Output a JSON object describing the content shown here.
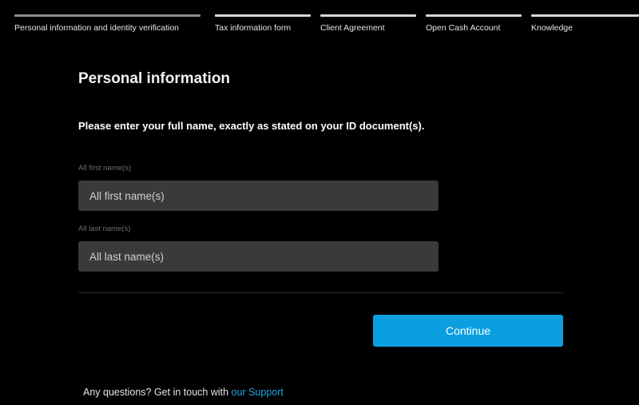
{
  "steps": [
    {
      "label": "Personal information and identity verification",
      "active": true
    },
    {
      "label": "Tax information form",
      "active": false
    },
    {
      "label": "Client Agreement",
      "active": false
    },
    {
      "label": "Open Cash Account",
      "active": false
    },
    {
      "label": "Knowledge",
      "active": false
    }
  ],
  "form": {
    "title": "Personal information",
    "instruction": "Please enter your full name, exactly as stated on your ID document(s).",
    "first_name": {
      "label": "All first name(s)",
      "placeholder": "All first name(s)",
      "value": ""
    },
    "last_name": {
      "label": "All last name(s)",
      "placeholder": "All last name(s)",
      "value": ""
    },
    "continue_label": "Continue"
  },
  "support": {
    "prefix": "Any questions? Get in touch with",
    "link_label": "our Support"
  },
  "colors": {
    "background": "#000000",
    "accent": "#0b9fe0",
    "input_bg": "#3a3a3a",
    "link": "#1ea5e6"
  }
}
